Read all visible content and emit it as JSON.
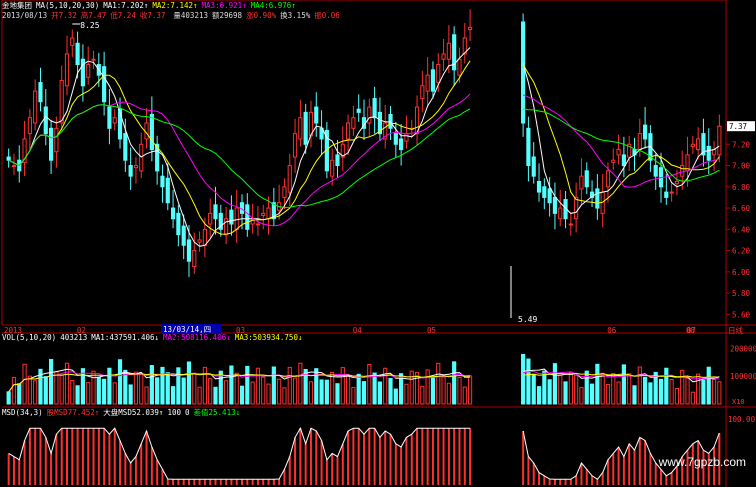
{
  "header": {
    "stock": "金地集团",
    "ma_label": "MA(5,10,20,30)",
    "ma_values": [
      {
        "label": "MA1:",
        "value": "7.202",
        "arrow": "↑",
        "color": "#ffffff"
      },
      {
        "label": "MA2:",
        "value": "7.142",
        "arrow": "↑",
        "color": "#ffff00"
      },
      {
        "label": "MA3:",
        "value": "6.921",
        "arrow": "↑",
        "color": "#ff00ff"
      },
      {
        "label": "MA4:",
        "value": "6.976",
        "arrow": "↑",
        "color": "#00ff00"
      }
    ],
    "date": "2013/08/13",
    "ohlc": [
      {
        "label": "开",
        "value": "7.32"
      },
      {
        "label": "高",
        "value": "7.47"
      },
      {
        "label": "低",
        "value": "7.24"
      },
      {
        "label": "收",
        "value": "7.37"
      }
    ],
    "volume": "量403213",
    "amount": "额29698",
    "change": "涨0.90%",
    "turnover": "换3.15%",
    "amplitude": "振0.06"
  },
  "vol_header": {
    "label": "VOL(5,10,20)",
    "value": "403213",
    "mas": [
      {
        "label": "MA1:",
        "value": "437591.406",
        "arrow": "↓",
        "color": "#ffffff"
      },
      {
        "label": "MA2:",
        "value": "508116.406",
        "arrow": "↓",
        "color": "#ff00ff"
      },
      {
        "label": "MA3:",
        "value": "503934.750",
        "arrow": "↓",
        "color": "#ffff00"
      }
    ]
  },
  "msd_header": {
    "label": "MSD(34,3)",
    "items": [
      {
        "label": "股MSD",
        "value": "77.452",
        "arrow": "↑",
        "color": "#ff3030"
      },
      {
        "label": "大盘MSD",
        "value": "52.039",
        "arrow": "↑",
        "color": "#ffffff"
      },
      {
        "label": "",
        "value": "100",
        "arrow": "",
        "color": "#ffffff"
      },
      {
        "label": "",
        "value": "0",
        "arrow": "",
        "color": "#ffffff"
      },
      {
        "label": "差值",
        "value": "25.413",
        "arrow": "↓",
        "color": "#00ff00"
      }
    ]
  },
  "annotations": {
    "high": "8.25",
    "low": "5.49",
    "cursor_date": "13/03/14,四",
    "last_price": "7.37",
    "axis_mode": "日线",
    "vol_unit": "X10",
    "msd_top": "100.00"
  },
  "watermark": "www.7gpzb.com",
  "colors": {
    "up": "#ff3030",
    "down": "#54ffff",
    "axis": "#b00000",
    "ma1": "#ffffff",
    "ma2": "#ffff00",
    "ma3": "#ff00ff",
    "ma4": "#00ff00"
  },
  "chart_data": [
    {
      "type": "candlestick",
      "x_tick_labels": [
        "2013",
        "02",
        "03",
        "04",
        "05",
        "06",
        "07",
        "08"
      ],
      "ylim": [
        5.5,
        8.35
      ],
      "y_ticks": [
        5.6,
        5.8,
        6.0,
        6.2,
        6.4,
        6.6,
        6.8,
        7.0,
        7.2
      ],
      "gap_days": [
        88,
        89,
        90,
        91,
        92,
        93,
        94,
        95,
        96
      ],
      "close": [
        7.05,
        7.0,
        6.95,
        7.25,
        7.45,
        7.7,
        7.6,
        7.3,
        7.05,
        7.35,
        7.8,
        8.05,
        8.2,
        7.95,
        7.75,
        7.95,
        8.0,
        7.85,
        7.6,
        7.35,
        7.45,
        7.25,
        7.05,
        6.9,
        7.0,
        7.2,
        7.4,
        7.15,
        6.95,
        6.8,
        6.65,
        6.5,
        6.35,
        6.25,
        6.1,
        6.2,
        6.3,
        6.4,
        6.55,
        6.5,
        6.4,
        6.5,
        6.45,
        6.6,
        6.55,
        6.4,
        6.5,
        6.45,
        6.55,
        6.6,
        6.5,
        6.65,
        6.8,
        7.0,
        7.3,
        7.45,
        7.2,
        7.5,
        7.4,
        7.25,
        6.95,
        7.05,
        7.0,
        7.2,
        7.4,
        7.45,
        7.5,
        7.35,
        7.55,
        7.45,
        7.3,
        7.4,
        7.35,
        7.2,
        7.15,
        7.3,
        7.35,
        7.55,
        7.75,
        7.85,
        7.7,
        7.95,
        8.05,
        8.15,
        7.9,
        8.0,
        8.2,
        8.3,
        7.4,
        7.0,
        6.9,
        6.75,
        6.7,
        6.65,
        6.55,
        6.6,
        6.5,
        6.45,
        6.7,
        6.9,
        6.8,
        6.7,
        6.6,
        6.75,
        6.95,
        7.05,
        7.15,
        7.0,
        7.2,
        7.1,
        7.3,
        7.25,
        7.05,
        6.9,
        6.8,
        6.7,
        6.75,
        6.85,
        7.0,
        7.1,
        7.2,
        7.25,
        7.1,
        7.05,
        7.15,
        7.37
      ],
      "ma_lines": [
        "MA1",
        "MA2",
        "MA3",
        "MA4"
      ]
    },
    {
      "type": "bar",
      "title": "VOL",
      "y_ticks": [
        100000,
        200000
      ],
      "ylim": [
        0,
        230000
      ]
    },
    {
      "type": "bar",
      "title": "MSD",
      "ylim": [
        0,
        100
      ]
    }
  ]
}
